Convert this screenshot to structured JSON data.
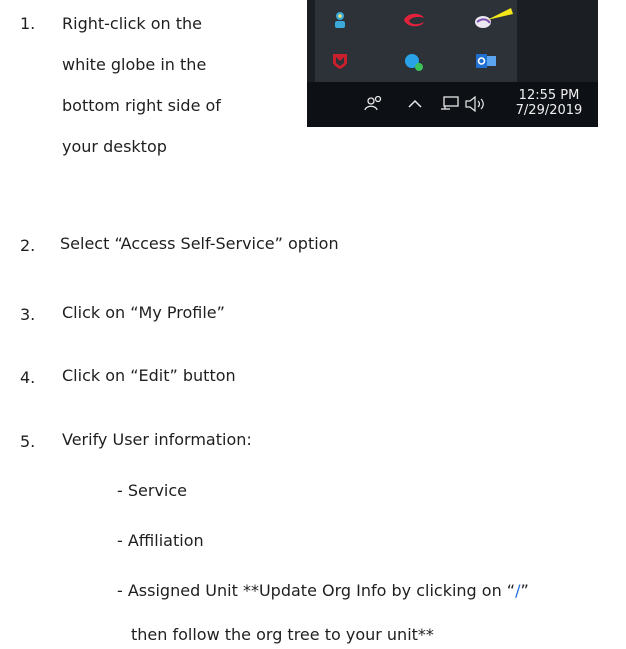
{
  "steps": [
    {
      "num": "1.",
      "lines": [
        "Right-click on the",
        "white globe in the",
        "bottom right side of",
        "your desktop"
      ]
    },
    {
      "num": "2.",
      "text": "Select “Access Self-Service” option"
    },
    {
      "num": "3.",
      "text": "Click on “My Profile”"
    },
    {
      "num": "4.",
      "text": "Click on “Edit” button"
    },
    {
      "num": "5.",
      "text": "Verify User information:"
    }
  ],
  "sub_items": [
    "- Service",
    "- Affiliation"
  ],
  "assigned_unit": {
    "prefix": "- Assigned Unit  **Update Org Info by clicking on “",
    "slash": "/",
    "suffix": "”",
    "continuation": "then follow the org tree to your unit**"
  },
  "taskbar": {
    "time": "12:55 PM",
    "date": "7/29/2019",
    "tray_icons": [
      "flower-icon",
      "red-arc-icon",
      "globe-icon",
      "mcafee-shield-icon",
      "skype-icon",
      "outlook-icon"
    ],
    "taskbar_icons": [
      "people-icon",
      "chevron-up-icon",
      "network-icon",
      "volume-icon"
    ],
    "colors": {
      "taskbar": "#0d1014",
      "tray": "#2c3238",
      "arrow": "#f5e61c"
    }
  }
}
